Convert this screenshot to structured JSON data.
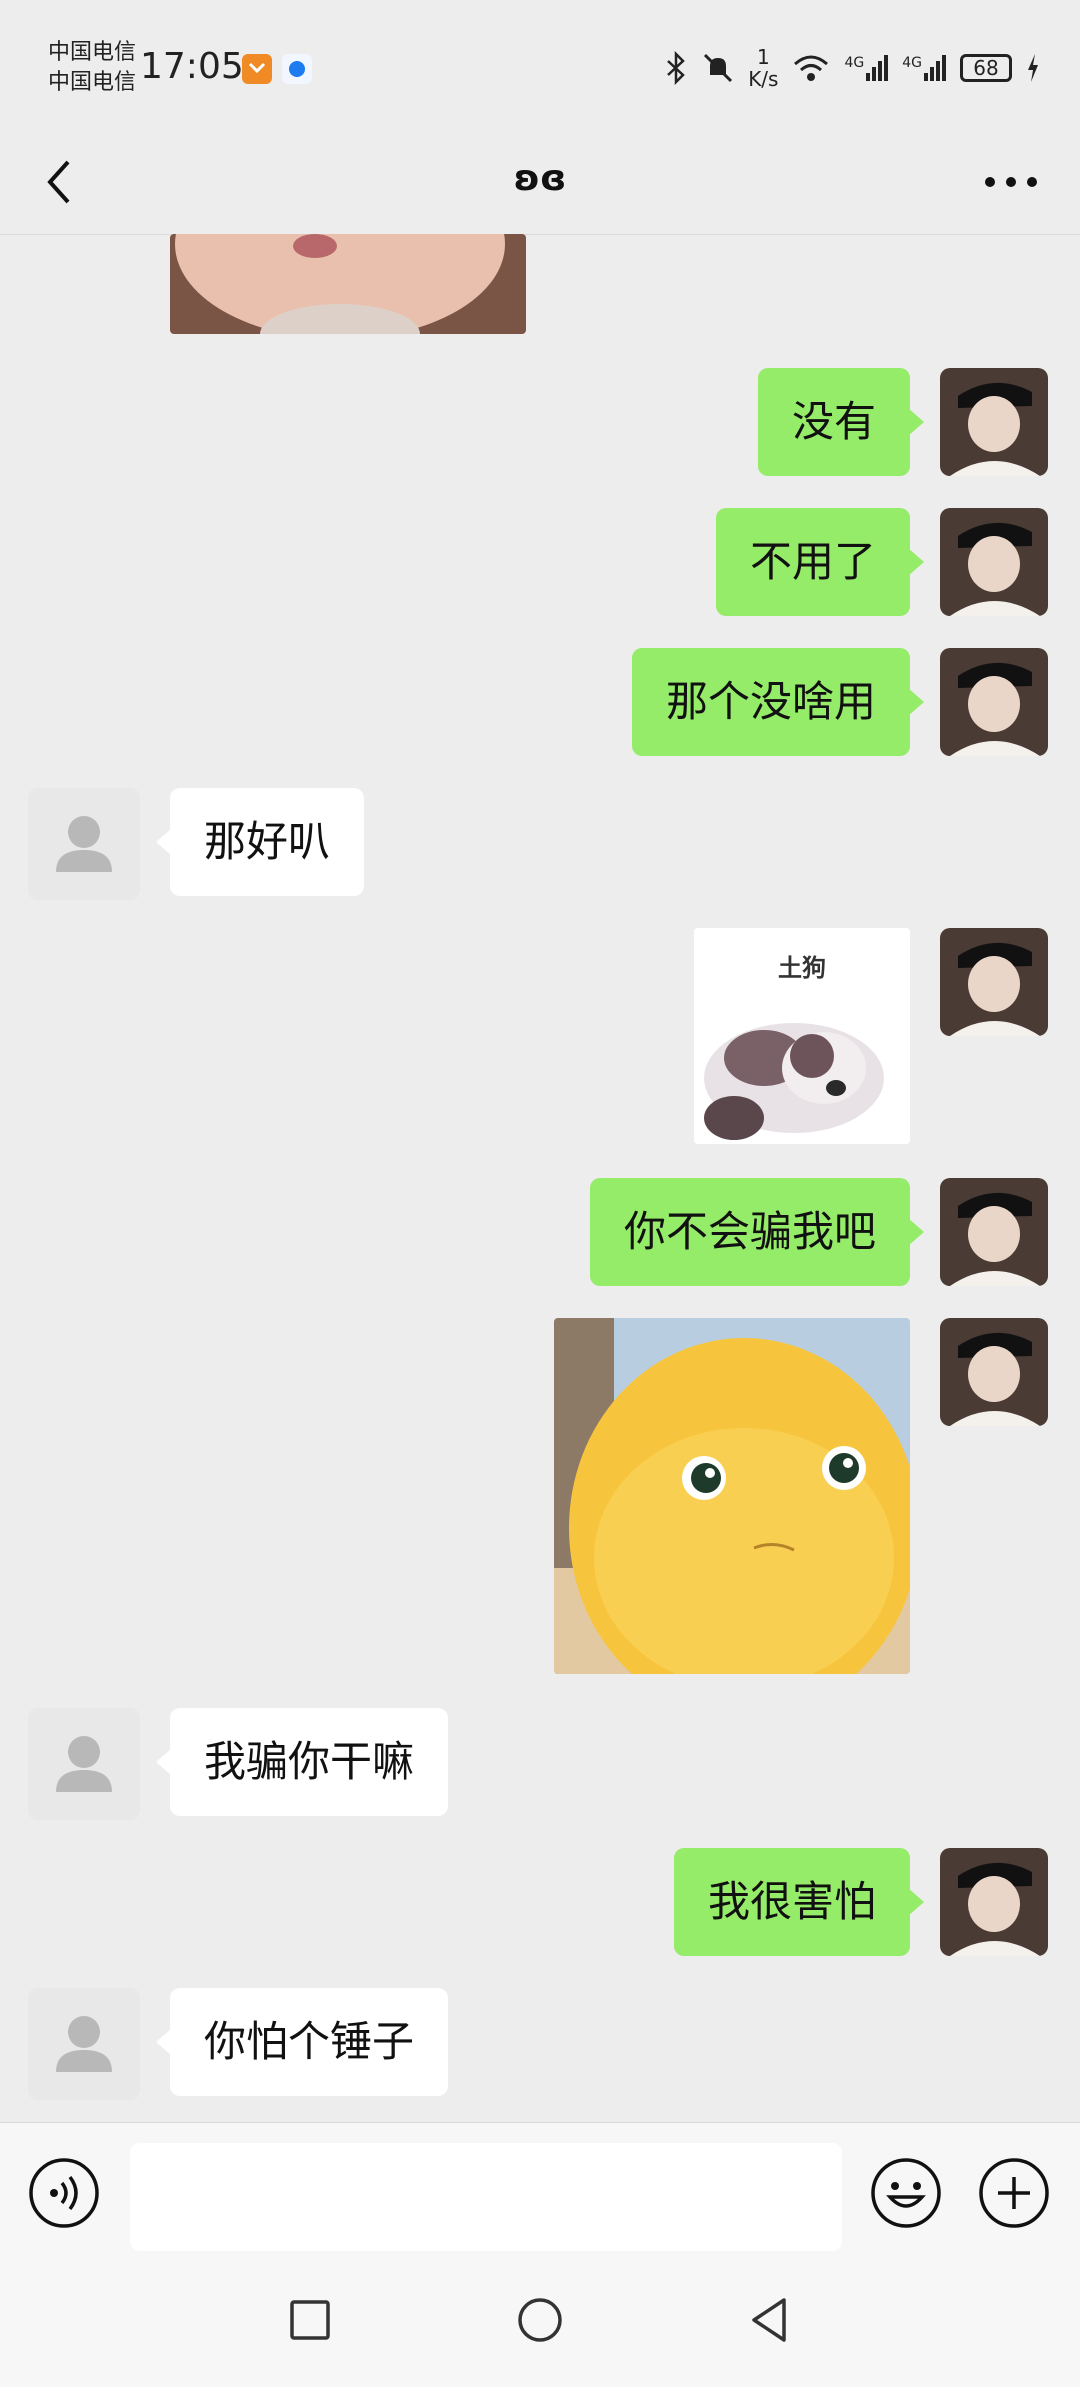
{
  "status_bar": {
    "carrier_1": "中国电信",
    "carrier_2": "中国电信",
    "time": "17:05",
    "net_speed_value": "1",
    "net_speed_unit": "K/s",
    "signal_1_label": "4G",
    "signal_2_label": "4G",
    "battery": "68"
  },
  "header": {
    "title": "ʚɞ"
  },
  "messages": [
    {
      "sender": "me",
      "type": "text",
      "text": "没有"
    },
    {
      "sender": "me",
      "type": "text",
      "text": "不用了"
    },
    {
      "sender": "me",
      "type": "text",
      "text": "那个没啥用"
    },
    {
      "sender": "other",
      "type": "text",
      "text": "那好叭"
    },
    {
      "sender": "me",
      "type": "sticker",
      "text": "土狗"
    },
    {
      "sender": "me",
      "type": "text",
      "text": "你不会骗我吧"
    },
    {
      "sender": "me",
      "type": "sticker",
      "text": ""
    },
    {
      "sender": "other",
      "type": "text",
      "text": "我骗你干嘛"
    },
    {
      "sender": "me",
      "type": "text",
      "text": "我很害怕"
    },
    {
      "sender": "other",
      "type": "text",
      "text": "你怕个锤子"
    }
  ],
  "colors": {
    "my_bubble": "#95ec69",
    "other_bubble": "#ffffff",
    "background": "#ededed"
  }
}
